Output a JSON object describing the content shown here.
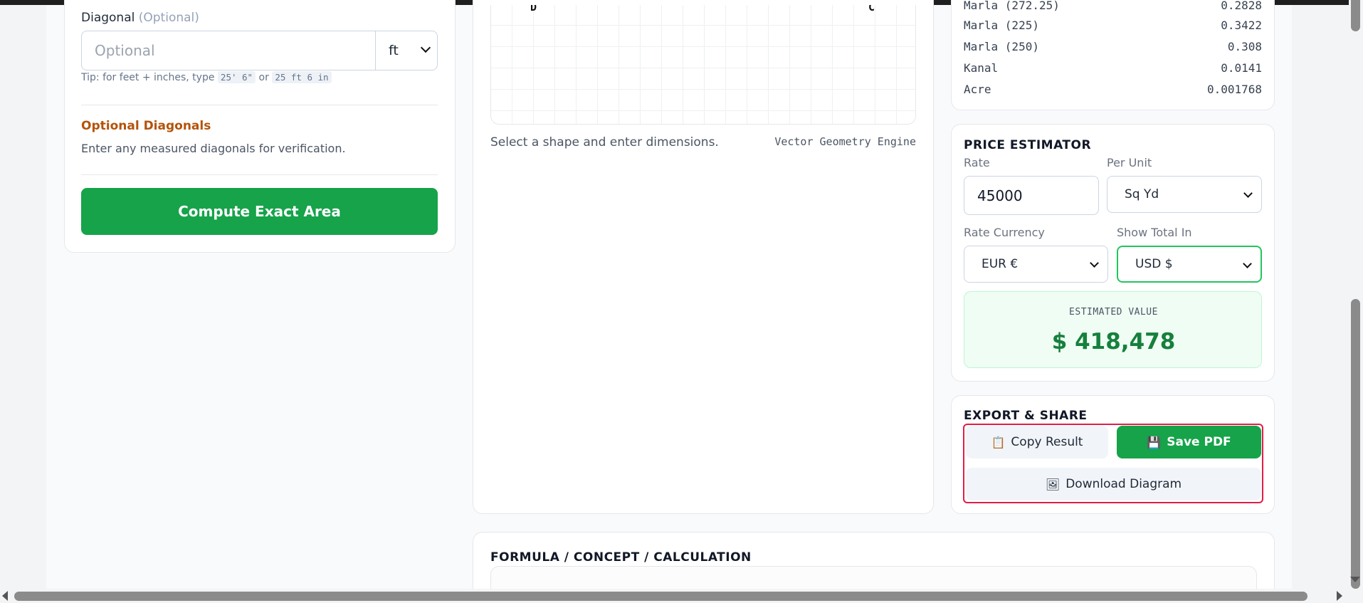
{
  "left": {
    "diagonal_label": "Diagonal",
    "diagonal_optional": "(Optional)",
    "diagonal_placeholder": "Optional",
    "unit_value": "ft",
    "tip_prefix": "Tip: for feet + inches, type",
    "tip_example_1": "25' 6\"",
    "tip_or": "or",
    "tip_example_2": "25 ft 6 in",
    "optional_diagonals_title": "Optional Diagonals",
    "optional_diagonals_desc": "Enter any measured diagonals for verification.",
    "compute_button": "Compute Exact Area"
  },
  "diagram": {
    "vertex_left": "D",
    "vertex_right": "C",
    "hint": "Select a shape and enter dimensions.",
    "engine": "Vector Geometry Engine"
  },
  "conversions": [
    {
      "unit": "Marla (272.25)",
      "value": "0.2828"
    },
    {
      "unit": "Marla (225)",
      "value": "0.3422"
    },
    {
      "unit": "Marla (250)",
      "value": "0.308"
    },
    {
      "unit": "Kanal",
      "value": "0.0141"
    },
    {
      "unit": "Acre",
      "value": "0.001768"
    }
  ],
  "price": {
    "title": "PRICE ESTIMATOR",
    "rate_label": "Rate",
    "rate_value": "45000",
    "per_unit_label": "Per Unit",
    "per_unit_value": "Sq Yd",
    "rate_currency_label": "Rate Currency",
    "rate_currency_value": "EUR €",
    "show_total_label": "Show Total In",
    "show_total_value": "USD $",
    "estimated_label": "ESTIMATED VALUE",
    "estimated_value": "$ 418,478"
  },
  "export": {
    "title": "EXPORT & SHARE",
    "copy_label": "Copy Result",
    "copy_icon": "📋",
    "save_label": "Save PDF",
    "save_icon": "💾",
    "download_label": "Download Diagram",
    "download_icon": "🖼"
  },
  "formula": {
    "title": "FORMULA / CONCEPT / CALCULATION"
  },
  "colors": {
    "primary_green": "#16a34a",
    "optional_title": "#b45309",
    "focus_ring": "#22c55e",
    "highlight_frame": "#e11d48"
  }
}
